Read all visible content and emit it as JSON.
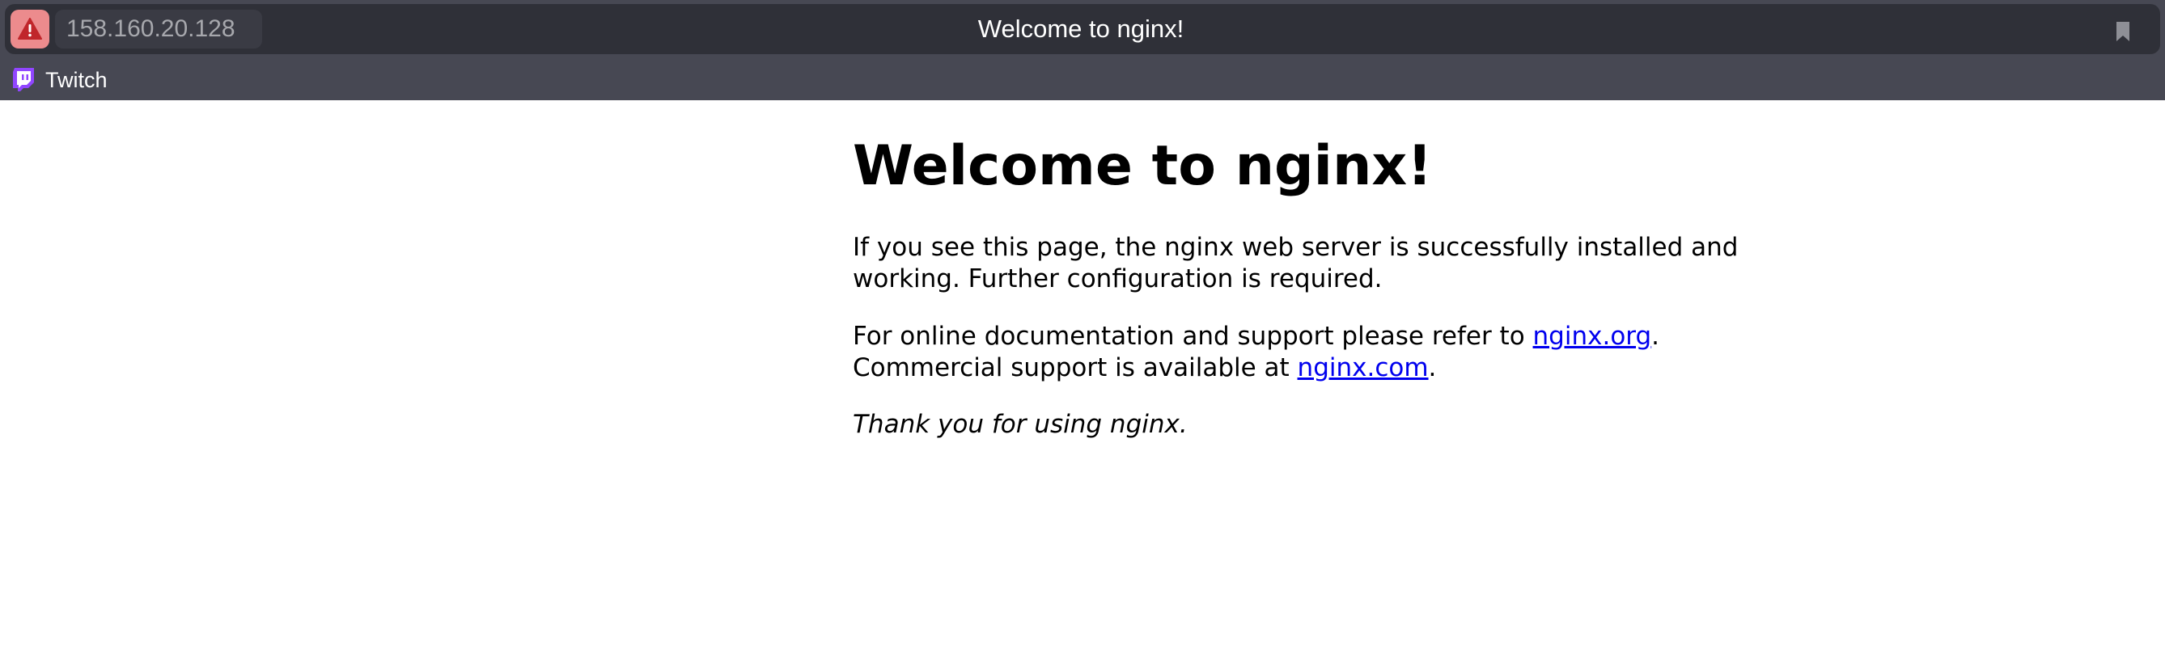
{
  "browser": {
    "url": "158.160.20.128",
    "tab_title": "Welcome to nginx!",
    "security_icon": "warning-icon",
    "bookmark_icon": "bookmark-icon",
    "bookmarks": [
      {
        "label": "Twitch",
        "icon": "twitch-icon"
      }
    ],
    "colors": {
      "chrome_bg": "#474853",
      "addressbar_bg": "#2f3038",
      "warning_bg": "#ec8b8d",
      "warning_icon": "#c0262b",
      "twitch_purple": "#9146ff"
    }
  },
  "page": {
    "heading": "Welcome to nginx!",
    "para1": "If you see this page, the nginx web server is successfully installed and working. Further configuration is required.",
    "para2": {
      "text_before": "For online documentation and support please refer to ",
      "link1": "nginx.org",
      "text_mid": ".",
      "text_line2": "Commercial support is available at ",
      "link2": "nginx.com",
      "text_end": "."
    },
    "para3": "Thank you for using nginx.",
    "colors": {
      "link": "#0000ee",
      "text": "#000000",
      "background": "#ffffff"
    }
  }
}
